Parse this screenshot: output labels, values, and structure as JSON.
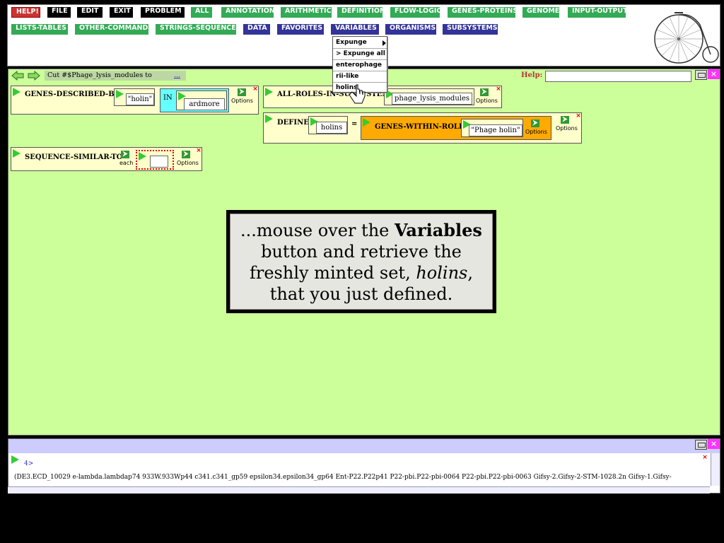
{
  "menu": {
    "row1": [
      {
        "label": "HELP!",
        "style": "red"
      },
      {
        "label": "FILE",
        "style": "black"
      },
      {
        "label": "EDIT",
        "style": "black"
      },
      {
        "label": "EXIT",
        "style": "black"
      },
      {
        "label": "PROBLEM",
        "style": "black"
      },
      {
        "label": "ALL",
        "style": "green"
      },
      {
        "label": "ANNOTATION",
        "style": "green"
      },
      {
        "label": "ARITHMETIC",
        "style": "green"
      },
      {
        "label": "DEFINITION",
        "style": "green"
      },
      {
        "label": "FLOW-LOGIC",
        "style": "green"
      },
      {
        "label": "GENES-PROTEINS",
        "style": "green"
      },
      {
        "label": "GENOME",
        "style": "green"
      },
      {
        "label": "INPUT-OUTPUT",
        "style": "green"
      }
    ],
    "row2": [
      {
        "label": "LISTS-TABLES",
        "style": "green"
      },
      {
        "label": "OTHER-COMMANDS",
        "style": "green"
      },
      {
        "label": "STRINGS-SEQUENCES",
        "style": "green"
      },
      {
        "label": "DATA",
        "style": "blue"
      },
      {
        "label": "FAVORITES",
        "style": "blue"
      },
      {
        "label": "VARIABLES",
        "style": "blue"
      },
      {
        "label": "ORGANISMS",
        "style": "blue"
      },
      {
        "label": "SUBSYSTEMS",
        "style": "blue"
      }
    ]
  },
  "dropdown": {
    "items": [
      "Expunge",
      "> Expunge all",
      "enterophage",
      "rii-like",
      "holins"
    ]
  },
  "workspace": {
    "cut_text": "Cut #$Phage_lysis_modules to",
    "cut_more": "...",
    "help_label": "Help:"
  },
  "blocks": {
    "genes_described_by": {
      "label": "GENES-DESCRIBED-BY",
      "arg1": "\"holin\"",
      "in_label": "IN",
      "arg2": "ardmore",
      "options": "Options"
    },
    "all_roles": {
      "label": "ALL-ROLES-IN-SUBSYSTEM",
      "arg": "phage_lysis_modules",
      "options": "Options"
    },
    "define": {
      "label": "DEFINE",
      "var": "holins",
      "equals": "=",
      "inner_label": "GENES-WITHIN-ROLE",
      "inner_arg": "\"Phage holin\"",
      "inner_options": "Options",
      "options": "Options"
    },
    "sequence_similar": {
      "label": "SEQUENCE-SIMILAR-TO",
      "each": "each",
      "options": "Options"
    }
  },
  "instruction": {
    "part1": "...mouse over the ",
    "bold": "Variables",
    "part2": " button and retrieve the freshly minted set, ",
    "italic": "holins",
    "part3": ", that you just defined."
  },
  "results": {
    "index": "4>",
    "line": "(DE3.ECD_10029 e-lambda.lambdap74 933W.933Wp44 c341.c341_gp59 epsilon34.epsilon34_gp64 Ent-P22.P22p41 P22-pbi.P22-pbi-0064 P22-pbi.P22-pbi-0063 Gifsy-2.Gifsy-2-STM-1028.2n Gifsy-1.Gifsy-"
  },
  "colors": {
    "workspace_bg": "#ccff99",
    "block_bg": "#ffffcc",
    "menu_green": "#33aa55",
    "menu_blue": "#333399",
    "menu_red": "#cc3333"
  }
}
